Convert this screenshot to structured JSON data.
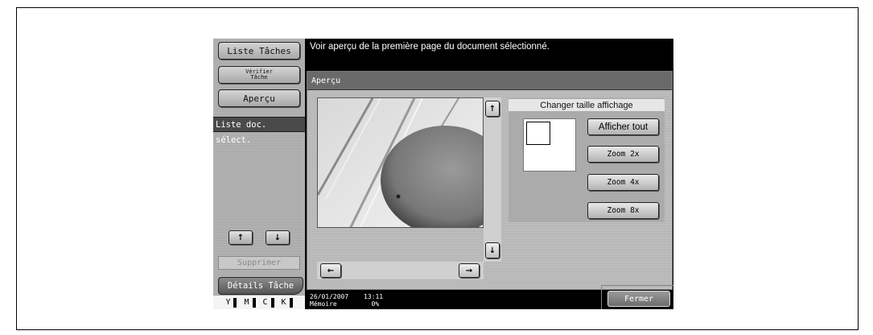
{
  "left_panel": {
    "liste_taches": "Liste Tâches",
    "verifier_tache_line1": "Vérifier",
    "verifier_tache_line2": "Tâche",
    "apercu": "Aperçu",
    "liste_doc": "Liste doc. sélect.",
    "up_arrow": "↑",
    "down_arrow": "↓",
    "supprimer": "Supprimer",
    "details_tache": "Détails Tâche",
    "toner": [
      "Y",
      "M",
      "C",
      "K"
    ]
  },
  "message": "Voir aperçu de la première page du document sélectionné.",
  "dialog": {
    "title": "Aperçu",
    "size_title": "Changer taille affichage",
    "afficher_tout": "Afficher tout",
    "zoom2": "Zoom 2x",
    "zoom4": "Zoom 4x",
    "zoom8": "Zoom 8x",
    "scroll_up": "↑",
    "scroll_down": "↓",
    "scroll_left": "←",
    "scroll_right": "→"
  },
  "status": {
    "date": "26/01/2007",
    "time": "13:11",
    "memory_label": "Mémoire",
    "memory_value": "0%"
  },
  "fermer": "Fermer"
}
